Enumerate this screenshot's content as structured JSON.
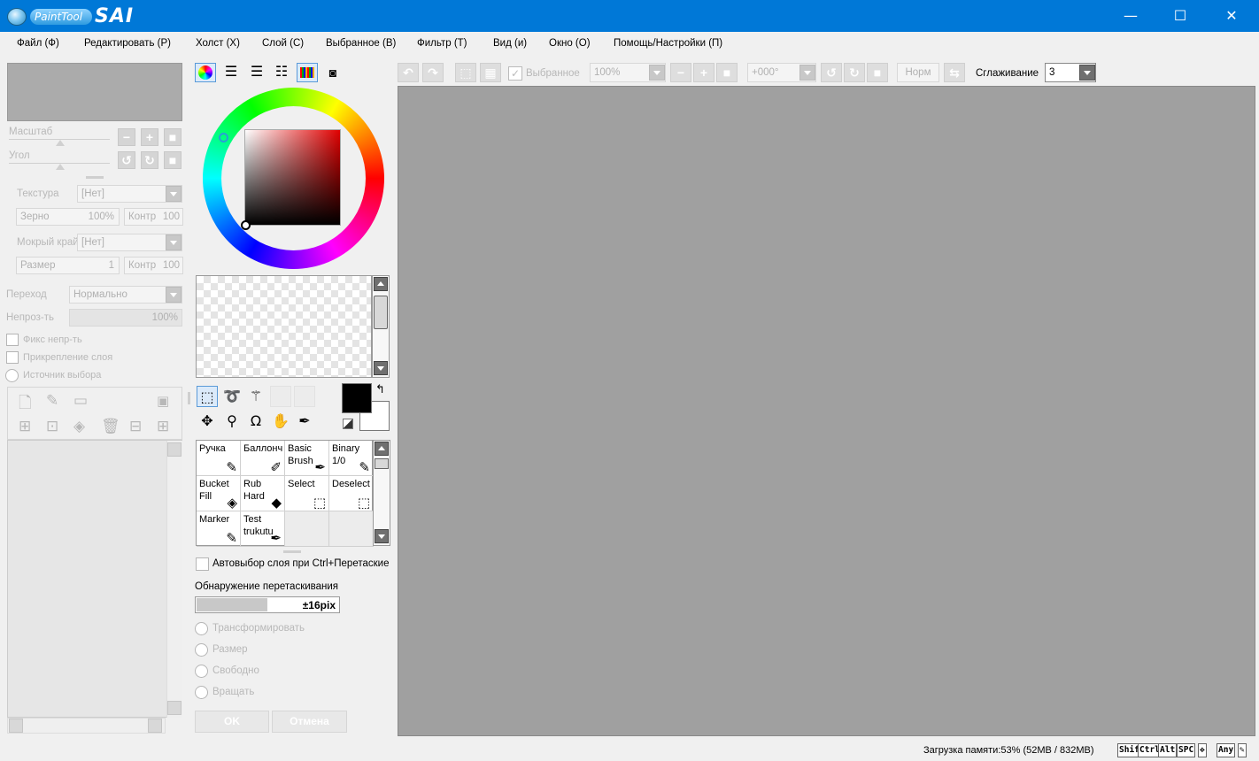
{
  "window": {
    "logo_text_paint": "PaintTool",
    "logo_text_sai": "SAI",
    "minimize": "—",
    "maximize": "☐",
    "close": "✕"
  },
  "menu": [
    "Файл (Ф)",
    "Редактировать (Р)",
    "Холст (Х)",
    "Слой (С)",
    "Выбранное (В)",
    "Фильтр (Т)",
    "Вид (и)",
    "Окно (О)",
    "Помощь/Настройки (П)"
  ],
  "navigator": {
    "scale_label": "Масштаб",
    "angle_label": "Угол"
  },
  "layer_props": {
    "texture_label": "Текстура",
    "texture_value": "[Нет]",
    "grain_label": "Зерно",
    "grain_value": "100%",
    "contrast_label": "Контр",
    "contrast_value": "100",
    "wet_edge_label": "Мокрый край",
    "wet_edge_value": "[Нет]",
    "size_label": "Размер",
    "size_value": "1",
    "contrast2_label": "Контр",
    "contrast2_value": "100",
    "blend_label": "Переход",
    "blend_value": "Нормально",
    "opacity_label": "Непроз-ть",
    "opacity_value": "100%",
    "preserve_opacity": "Фикс непр-ть",
    "clip_layer": "Прикрепление слоя",
    "selection_source": "Источник выбора"
  },
  "brushes": [
    {
      "name": "Ручка",
      "icon": "pen-icon",
      "glyph": "✎"
    },
    {
      "name": "Баллонч",
      "icon": "airbrush-icon",
      "glyph": "✐"
    },
    {
      "name": "Basic Brush",
      "icon": "brush-icon",
      "glyph": "✒"
    },
    {
      "name": "Binary 1/0",
      "icon": "binary-pen-icon",
      "glyph": "✎"
    },
    {
      "name": "Bucket Fill",
      "icon": "bucket-icon",
      "glyph": "◈"
    },
    {
      "name": "Rub Hard",
      "icon": "eraser-icon",
      "glyph": "◆"
    },
    {
      "name": "Select",
      "icon": "select-brush-icon",
      "glyph": "⬚"
    },
    {
      "name": "Deselect",
      "icon": "deselect-brush-icon",
      "glyph": "⬚"
    },
    {
      "name": "Marker",
      "icon": "marker-icon",
      "glyph": "✎"
    },
    {
      "name": "Test trukutu",
      "icon": "brush-icon",
      "glyph": "✒"
    }
  ],
  "tool_options": {
    "auto_select_label": "Автовыбор слоя при Ctrl+Перетаские",
    "drag_detect_label": "Обнаружение перетаскивания",
    "drag_detect_value": "±16pix",
    "drag_detect_fraction": 0.5,
    "transform": "Трансформировать",
    "resize": "Размер",
    "free": "Свободно",
    "rotate": "Вращать",
    "ok": "OK",
    "cancel": "Отмена"
  },
  "canvas_toolbar": {
    "selected_label": "Выбранное",
    "zoom_value": "100%",
    "angle_value": "+000°",
    "blend_mode": "Норм",
    "smoothing_label": "Сглаживание",
    "smoothing_value": "3"
  },
  "status": {
    "memory": "Загрузка памяти:53% (52MB / 832MB)",
    "keys": [
      "Shift",
      "Ctrl",
      "Alt",
      "SPC",
      "✥",
      "Any",
      "✎"
    ]
  }
}
